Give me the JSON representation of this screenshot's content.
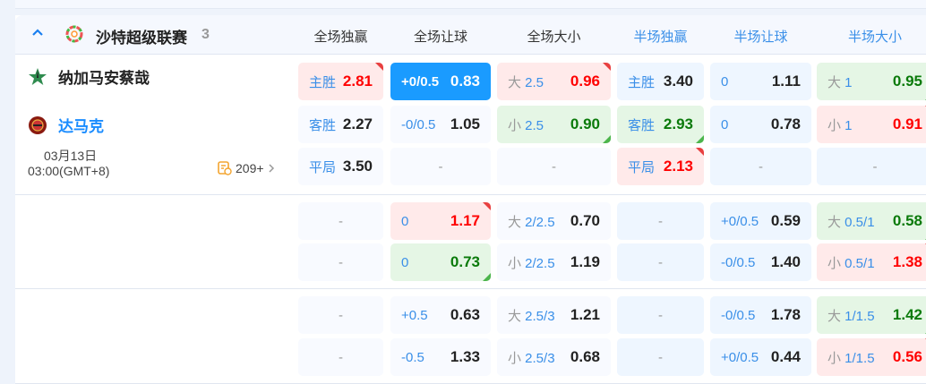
{
  "league": {
    "name": "沙特超级联赛",
    "count": "3"
  },
  "columns": [
    {
      "label": "全场独赢",
      "half": false
    },
    {
      "label": "全场让球",
      "half": false
    },
    {
      "label": "全场大小",
      "half": false
    },
    {
      "label": "半场独赢",
      "half": true
    },
    {
      "label": "半场让球",
      "half": true
    },
    {
      "label": "半场大小",
      "half": true
    }
  ],
  "match": {
    "home": "纳加马安蔡哉",
    "away": "达马克",
    "date": "03月13日",
    "time": "03:00(GMT+8)",
    "more_count": "209+"
  },
  "colors": {
    "accent": "#1a9bff",
    "up": "#e84040",
    "down": "#4cb54c"
  },
  "blocks": [
    [
      [
        {
          "pre": "",
          "lab": "主胜",
          "val": "2.81",
          "st": "red",
          "c": "up"
        },
        {
          "pre": "",
          "lab": "客胜",
          "val": "2.27"
        },
        {
          "pre": "",
          "lab": "平局",
          "val": "3.50"
        }
      ],
      [
        {
          "lab": "+0/0.5",
          "val": "0.83",
          "st": "sel"
        },
        {
          "lab": "-0/0.5",
          "val": "1.05"
        },
        {
          "empty": true
        }
      ],
      [
        {
          "pre": "大",
          "lab": "2.5",
          "val": "0.96",
          "st": "red",
          "c": "up"
        },
        {
          "pre": "小",
          "lab": "2.5",
          "val": "0.90",
          "st": "green",
          "c": "down"
        },
        {
          "empty": true
        }
      ],
      [
        {
          "lab": "主胜",
          "val": "3.40"
        },
        {
          "lab": "客胜",
          "val": "2.93",
          "st": "green",
          "c": "down"
        },
        {
          "lab": "平局",
          "val": "2.13",
          "st": "red",
          "c": "up"
        }
      ],
      [
        {
          "lab": "0",
          "val": "1.11"
        },
        {
          "lab": "0",
          "val": "0.78"
        },
        {
          "empty": true
        }
      ],
      [
        {
          "pre": "大",
          "lab": "1",
          "val": "0.95",
          "st": "green",
          "c": "down"
        },
        {
          "pre": "小",
          "lab": "1",
          "val": "0.91",
          "st": "red",
          "c": "up"
        },
        {
          "empty": true
        }
      ]
    ],
    [
      [
        {
          "empty": true
        },
        {
          "empty": true
        }
      ],
      [
        {
          "lab": "0",
          "val": "1.17",
          "st": "red",
          "c": "up"
        },
        {
          "lab": "0",
          "val": "0.73",
          "st": "green",
          "c": "down"
        }
      ],
      [
        {
          "pre": "大",
          "lab": "2/2.5",
          "val": "0.70"
        },
        {
          "pre": "小",
          "lab": "2/2.5",
          "val": "1.19"
        }
      ],
      [
        {
          "empty": true
        },
        {
          "empty": true
        }
      ],
      [
        {
          "lab": "+0/0.5",
          "val": "0.59"
        },
        {
          "lab": "-0/0.5",
          "val": "1.40"
        }
      ],
      [
        {
          "pre": "大",
          "lab": "0.5/1",
          "val": "0.58",
          "st": "green",
          "c": "down"
        },
        {
          "pre": "小",
          "lab": "0.5/1",
          "val": "1.38",
          "st": "red",
          "c": "up"
        }
      ]
    ],
    [
      [
        {
          "empty": true
        },
        {
          "empty": true
        }
      ],
      [
        {
          "lab": "+0.5",
          "val": "0.63"
        },
        {
          "lab": "-0.5",
          "val": "1.33"
        }
      ],
      [
        {
          "pre": "大",
          "lab": "2.5/3",
          "val": "1.21"
        },
        {
          "pre": "小",
          "lab": "2.5/3",
          "val": "0.68"
        }
      ],
      [
        {
          "empty": true
        },
        {
          "empty": true
        }
      ],
      [
        {
          "lab": "-0/0.5",
          "val": "1.78"
        },
        {
          "lab": "+0/0.5",
          "val": "0.44"
        }
      ],
      [
        {
          "pre": "大",
          "lab": "1/1.5",
          "val": "1.42",
          "st": "green",
          "c": "down"
        },
        {
          "pre": "小",
          "lab": "1/1.5",
          "val": "0.56",
          "st": "red",
          "c": "up"
        }
      ]
    ]
  ],
  "empty_text": "-"
}
